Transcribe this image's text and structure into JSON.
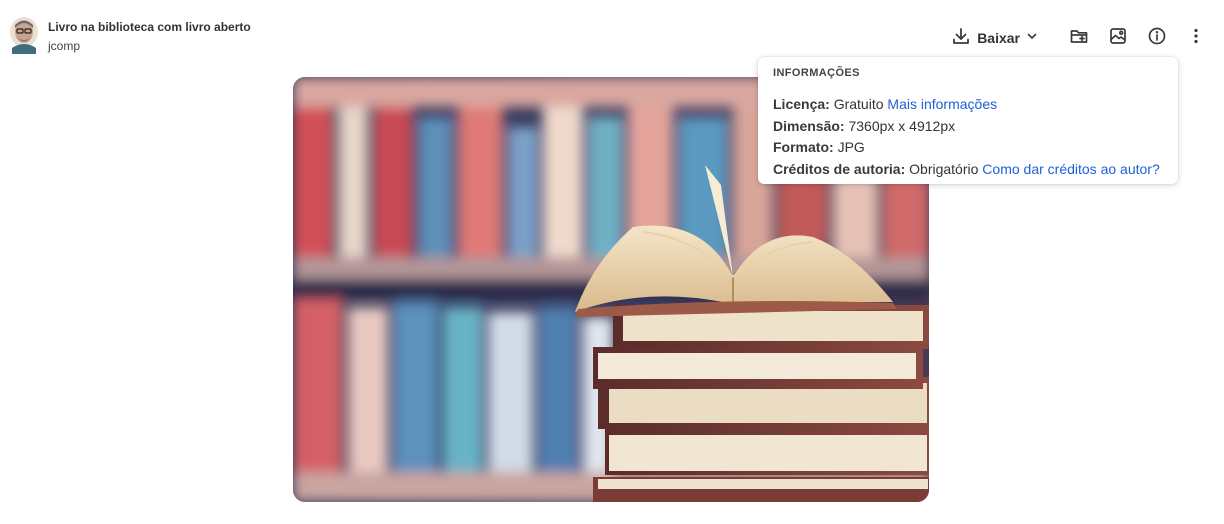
{
  "header": {
    "title": "Livro na biblioteca com livro aberto",
    "author": "jcomp"
  },
  "toolbar": {
    "download_label": "Baixar"
  },
  "info": {
    "heading": "INFORMAÇÕES",
    "license_label": "Licença:",
    "license_value": "Gratuito",
    "license_link": "Mais informações",
    "dimension_label": "Dimensão:",
    "dimension_value": "7360px x 4912px",
    "format_label": "Formato:",
    "format_value": "JPG",
    "credits_label": "Créditos de autoria:",
    "credits_value": "Obrigatório",
    "credits_link": "Como dar créditos ao autor?"
  },
  "colors": {
    "link": "#1f5fd9",
    "text": "#333333"
  },
  "icons": {
    "download": "download-icon",
    "chevron": "chevron-down-icon",
    "folder": "folder-plus-icon",
    "collection": "image-collection-icon",
    "info": "info-icon",
    "more": "more-vertical-icon"
  }
}
